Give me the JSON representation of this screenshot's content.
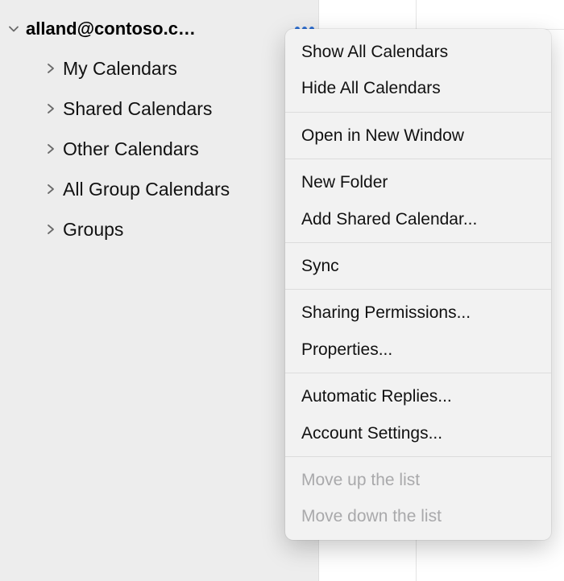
{
  "account": {
    "label": "alland@contoso.c…"
  },
  "sidebar": {
    "items": [
      {
        "label": "My Calendars"
      },
      {
        "label": "Shared Calendars"
      },
      {
        "label": "Other Calendars"
      },
      {
        "label": "All Group Calendars"
      },
      {
        "label": "Groups"
      }
    ]
  },
  "menu": {
    "show_all": "Show All Calendars",
    "hide_all": "Hide All Calendars",
    "open_window": "Open in New Window",
    "new_folder": "New Folder",
    "add_shared": "Add Shared Calendar...",
    "sync": "Sync",
    "sharing_perms": "Sharing Permissions...",
    "properties": "Properties...",
    "auto_replies": "Automatic Replies...",
    "account_settings": "Account Settings...",
    "move_up": "Move up the list",
    "move_down": "Move down the list"
  }
}
